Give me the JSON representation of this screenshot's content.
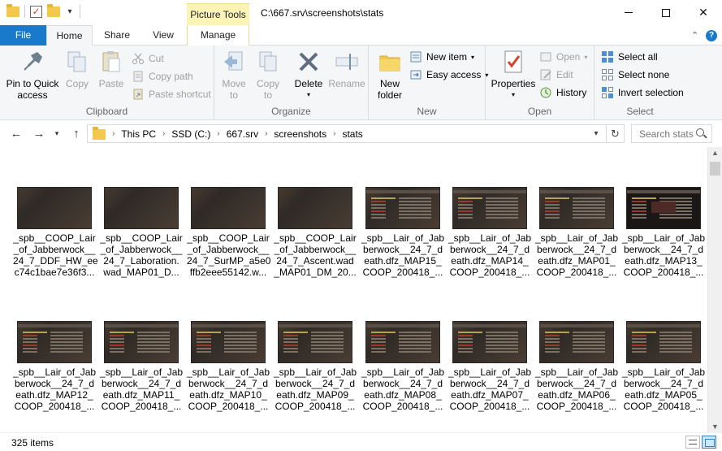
{
  "window": {
    "title_path": "C:\\667.srv\\screenshots\\stats",
    "context_tab": "Picture Tools"
  },
  "tabs": {
    "file": "File",
    "home": "Home",
    "share": "Share",
    "view": "View",
    "manage": "Manage"
  },
  "ribbon": {
    "clipboard": {
      "label": "Clipboard",
      "pin": "Pin to Quick\naccess",
      "copy": "Copy",
      "paste": "Paste",
      "cut": "Cut",
      "copy_path": "Copy path",
      "paste_shortcut": "Paste shortcut"
    },
    "organize": {
      "label": "Organize",
      "move_to": "Move\nto",
      "copy_to": "Copy\nto",
      "delete": "Delete",
      "rename": "Rename"
    },
    "new": {
      "label": "New",
      "new_folder": "New\nfolder",
      "new_item": "New item",
      "easy_access": "Easy access"
    },
    "open": {
      "label": "Open",
      "properties": "Properties",
      "open": "Open",
      "edit": "Edit",
      "history": "History"
    },
    "select": {
      "label": "Select",
      "select_all": "Select all",
      "select_none": "Select none",
      "invert_selection": "Invert selection"
    }
  },
  "address": {
    "crumbs": [
      "This PC",
      "SSD (C:)",
      "667.srv",
      "screenshots",
      "stats"
    ],
    "search_placeholder": "Search stats"
  },
  "files": [
    "_spb__COOP_Lair\n_of_Jabberwock__\n24_7_DDF_HW_ee\nc74c1bae7e36f3...",
    "_spb__COOP_Lair\n_of_Jabberwock__\n24_7_Laboration.\nwad_MAP01_D...",
    "_spb__COOP_Lair\n_of_Jabberwock__\n24_7_SurMP_a5e0\nffb2eee55142.w...",
    "_spb__COOP_Lair\n_of_Jabberwock__\n24_7_Ascent.wad\n_MAP01_DM_20...",
    "_spb__Lair_of_Jab\nberwock__24_7_d\neath.dfz_MAP15_\nCOOP_200418_...",
    "_spb__Lair_of_Jab\nberwock__24_7_d\neath.dfz_MAP14_\nCOOP_200418_...",
    "_spb__Lair_of_Jab\nberwock__24_7_d\neath.dfz_MAP01_\nCOOP_200418_...",
    "_spb__Lair_of_Jab\nberwock__24_7_d\neath.dfz_MAP13_\nCOOP_200418_...",
    "_spb__Lair_of_Jab\nberwock__24_7_d\neath.dfz_MAP12_\nCOOP_200418_...",
    "_spb__Lair_of_Jab\nberwock__24_7_d\neath.dfz_MAP11_\nCOOP_200418_...",
    "_spb__Lair_of_Jab\nberwock__24_7_d\neath.dfz_MAP10_\nCOOP_200418_...",
    "_spb__Lair_of_Jab\nberwock__24_7_d\neath.dfz_MAP09_\nCOOP_200418_...",
    "_spb__Lair_of_Jab\nberwock__24_7_d\neath.dfz_MAP08_\nCOOP_200418_...",
    "_spb__Lair_of_Jab\nberwock__24_7_d\neath.dfz_MAP07_\nCOOP_200418_...",
    "_spb__Lair_of_Jab\nberwock__24_7_d\neath.dfz_MAP06_\nCOOP_200418_...",
    "_spb__Lair_of_Jab\nberwock__24_7_d\neath.dfz_MAP05_\nCOOP_200418_..."
  ],
  "status": {
    "item_count": "325 items"
  },
  "colors": {
    "file_tab": "#1979ca",
    "context_tab": "#fbf4b6",
    "ribbon_bg": "#f5f6f7"
  }
}
